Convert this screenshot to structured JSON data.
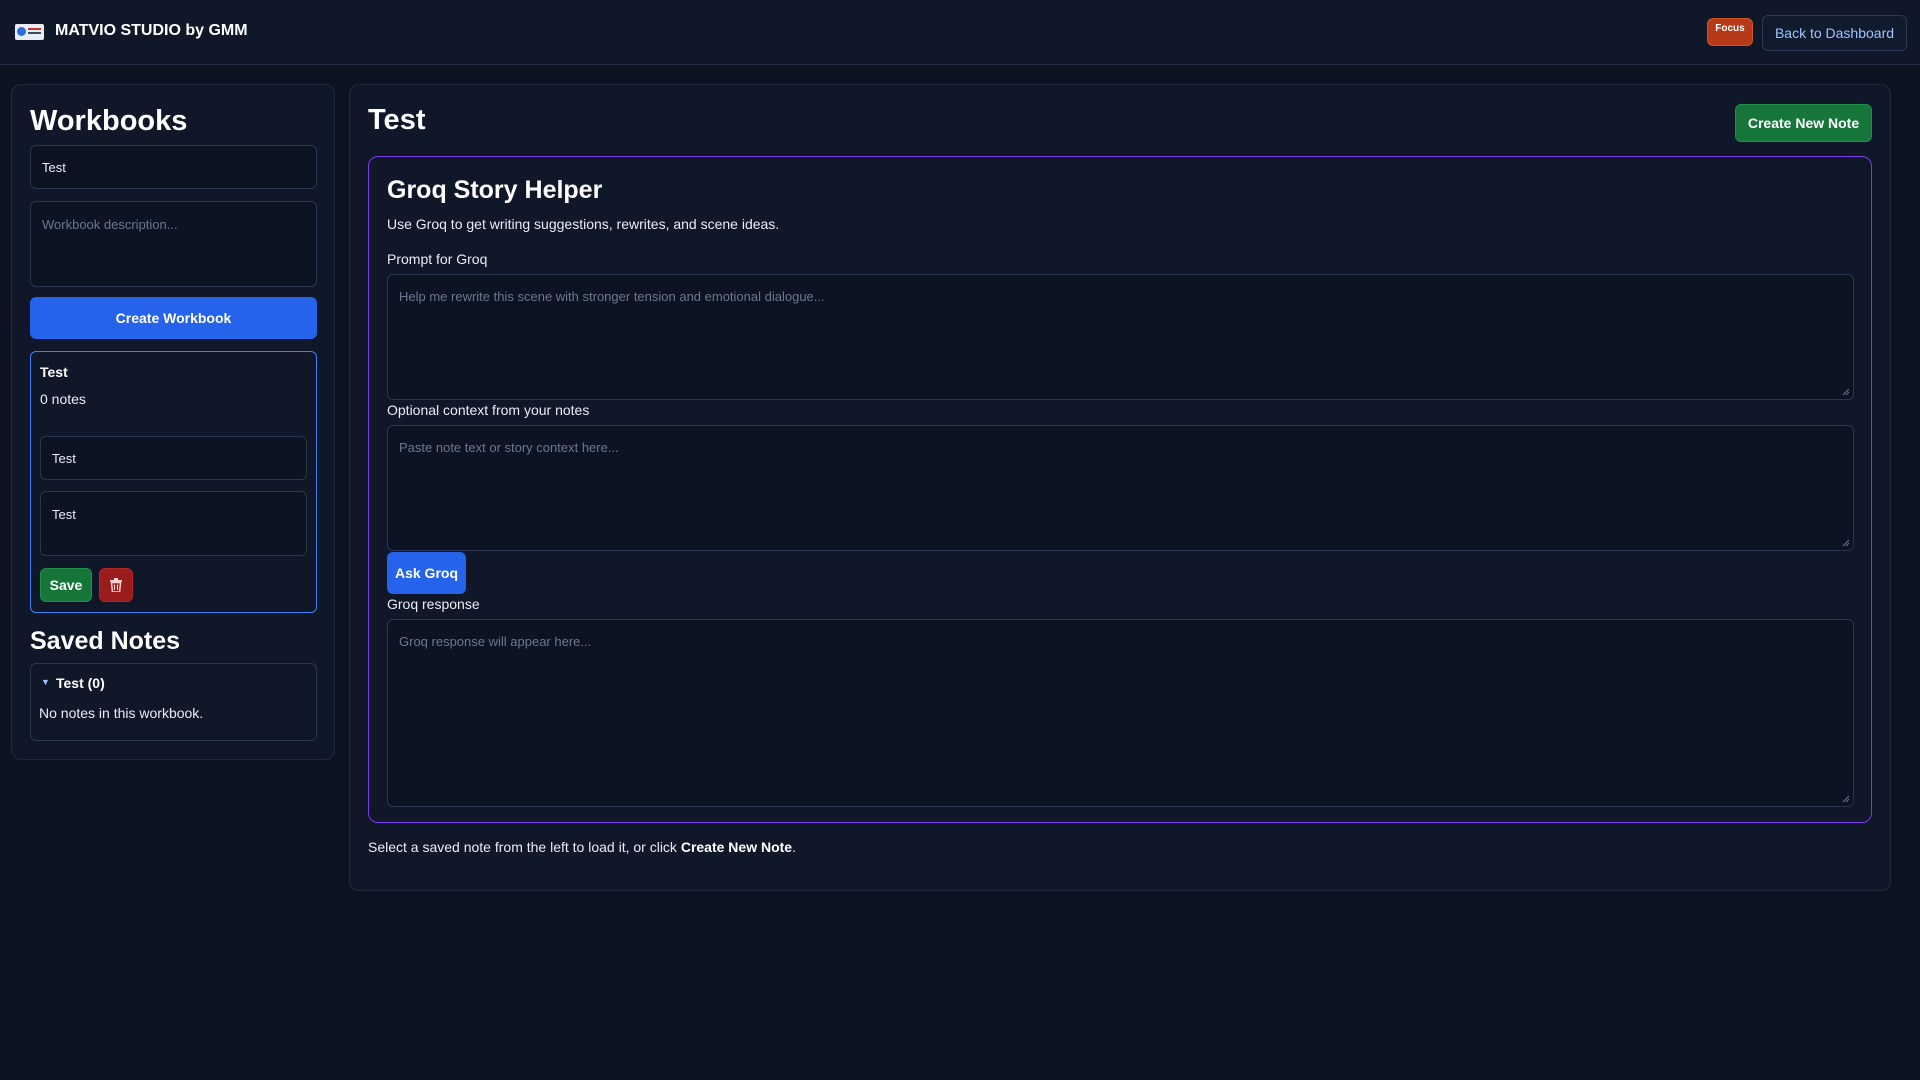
{
  "header": {
    "app_title": "MATVIO STUDIO by GMM",
    "focus_label": "Focus",
    "back_label": "Back to Dashboard"
  },
  "sidebar": {
    "heading": "Workbooks",
    "name_value": "Test",
    "description_placeholder": "Workbook description...",
    "create_label": "Create Workbook",
    "selected_workbook": {
      "title": "Test",
      "count_text": "0 notes",
      "name_value": "Test",
      "description_value": "Test",
      "save_label": "Save",
      "delete_icon": "trash-icon"
    },
    "saved_notes": {
      "heading": "Saved Notes",
      "group_label": "Test (0)",
      "empty_text": "No notes in this workbook."
    }
  },
  "main": {
    "title": "Test",
    "new_note_label": "Create New Note",
    "groq": {
      "title": "Groq Story Helper",
      "subtitle": "Use Groq to get writing suggestions, rewrites, and scene ideas.",
      "prompt_label": "Prompt for Groq",
      "prompt_placeholder": "Help me rewrite this scene with stronger tension and emotional dialogue...",
      "context_label": "Optional context from your notes",
      "context_placeholder": "Paste note text or story context here...",
      "ask_label": "Ask Groq",
      "response_label": "Groq response",
      "response_placeholder": "Groq response will appear here..."
    },
    "helper_prefix": "Select a saved note from the left to load it, or click ",
    "helper_link": "Create New Note",
    "helper_suffix": "."
  },
  "colors": {
    "background": "#0c1220",
    "primary_blue": "#2563eb",
    "success_green": "#16763a",
    "danger_red": "#9b1c1c",
    "focus_orange": "#b63a17",
    "panel_purple": "#7c3aed"
  }
}
